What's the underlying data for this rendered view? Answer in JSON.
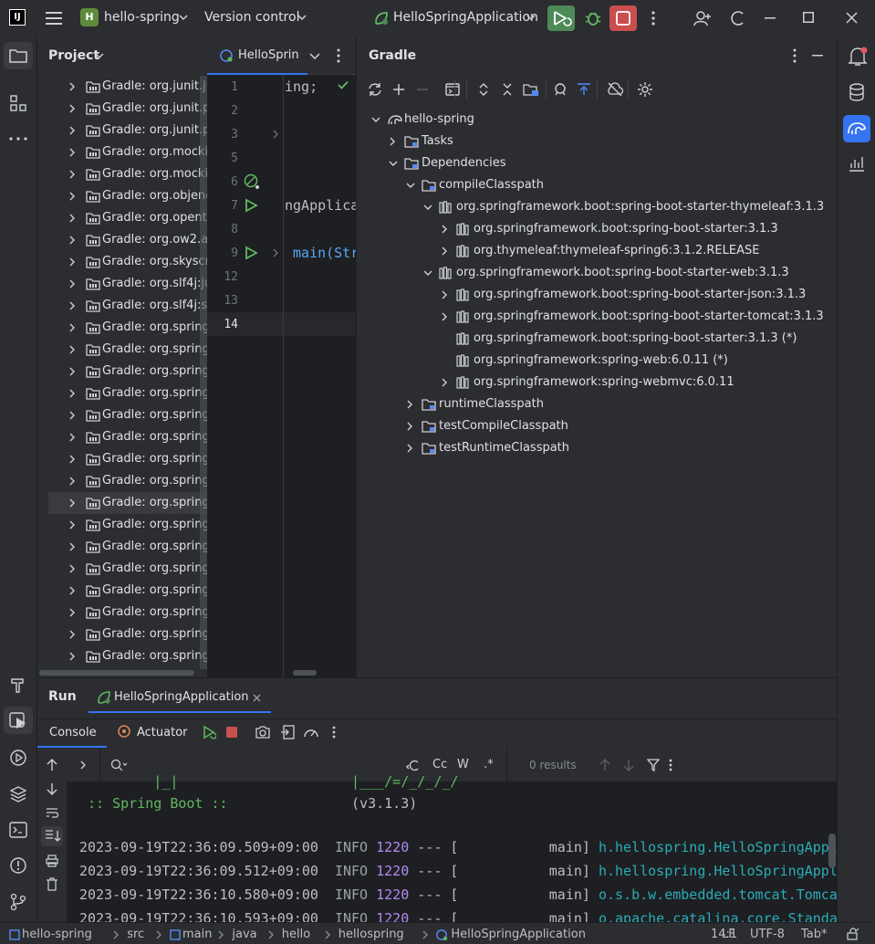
{
  "titlebar": {
    "project_badge": "H",
    "project_name": "hello-spring",
    "vcs": "Version control",
    "run_config": "HelloSpringApplication"
  },
  "project_panel": {
    "title": "Project",
    "rows": [
      "Gradle: org.junit.ju",
      "Gradle: org.junit.pl",
      "Gradle: org.junit.pl",
      "Gradle: org.mockit",
      "Gradle: org.mockit",
      "Gradle: org.objene",
      "Gradle: org.opente",
      "Gradle: org.ow2.as",
      "Gradle: org.skyscre",
      "Gradle: org.slf4j:ju",
      "Gradle: org.slf4j:sl",
      "Gradle: org.springf",
      "Gradle: org.springf",
      "Gradle: org.springf",
      "Gradle: org.springf",
      "Gradle: org.springf",
      "Gradle: org.springf",
      "Gradle: org.springf",
      "Gradle: org.springf",
      "Gradle: org.springf",
      "Gradle: org.springf",
      "Gradle: org.springf",
      "Gradle: org.springf",
      "Gradle: org.springf",
      "Gradle: org.springf",
      "Gradle: org.springf",
      "Gradle: org.springf"
    ],
    "selected_index": 19
  },
  "editor": {
    "tab_label": "HelloSprin",
    "line_numbers": [
      "1",
      "2",
      "3",
      "5",
      "6",
      "7",
      "8",
      "9",
      "12",
      "13",
      "14"
    ],
    "code": {
      "l1": "ing;",
      "l7": "ngApplica",
      "l9": "main(Str"
    }
  },
  "gradle": {
    "title": "Gradle",
    "tree": [
      {
        "label": "hello-spring",
        "level": 0,
        "expanded": true,
        "icon": "gradle-elephant-icon"
      },
      {
        "label": "Tasks",
        "level": 1,
        "expanded": false,
        "icon": "folder-icon"
      },
      {
        "label": "Dependencies",
        "level": 1,
        "expanded": true,
        "icon": "folder-icon"
      },
      {
        "label": "compileClasspath",
        "level": 2,
        "expanded": true,
        "icon": "folder-icon"
      },
      {
        "label": "org.springframework.boot:spring-boot-starter-thymeleaf:3.1.3",
        "level": 3,
        "expanded": true,
        "icon": "library-icon"
      },
      {
        "label": "org.springframework.boot:spring-boot-starter:3.1.3",
        "level": 4,
        "expanded": false,
        "icon": "library-icon"
      },
      {
        "label": "org.thymeleaf:thymeleaf-spring6:3.1.2.RELEASE",
        "level": 4,
        "expanded": false,
        "icon": "library-icon"
      },
      {
        "label": "org.springframework.boot:spring-boot-starter-web:3.1.3",
        "level": 3,
        "expanded": true,
        "icon": "library-icon"
      },
      {
        "label": "org.springframework.boot:spring-boot-starter-json:3.1.3",
        "level": 4,
        "expanded": false,
        "icon": "library-icon"
      },
      {
        "label": "org.springframework.boot:spring-boot-starter-tomcat:3.1.3",
        "level": 4,
        "expanded": false,
        "icon": "library-icon"
      },
      {
        "label": "org.springframework.boot:spring-boot-starter:3.1.3 (*)",
        "level": 4,
        "leaf": true,
        "icon": "library-icon"
      },
      {
        "label": "org.springframework:spring-web:6.0.11 (*)",
        "level": 4,
        "leaf": true,
        "icon": "library-icon"
      },
      {
        "label": "org.springframework:spring-webmvc:6.0.11",
        "level": 4,
        "expanded": false,
        "icon": "library-icon"
      },
      {
        "label": "runtimeClasspath",
        "level": 2,
        "expanded": false,
        "icon": "folder-icon"
      },
      {
        "label": "testCompileClasspath",
        "level": 2,
        "expanded": false,
        "icon": "folder-icon"
      },
      {
        "label": "testRuntimeClasspath",
        "level": 2,
        "expanded": false,
        "icon": "folder-icon"
      }
    ]
  },
  "run_panel": {
    "title": "Run",
    "tab": "HelloSpringApplication",
    "subtabs": {
      "console": "Console",
      "actuator": "Actuator"
    },
    "search": {
      "results": "0 results",
      "cc": "Cc",
      "w": "W",
      "regex": ".*"
    },
    "log": {
      "banner_cut": "         |_|                     |___/=/_/_/_/",
      "banner_name": " :: Spring Boot :: ",
      "banner_version": "              (v3.1.3)",
      "lines": [
        {
          "time": "2023-09-19T22:36:09.509+09:00",
          "level": "INFO",
          "pid": "1220",
          "sep": " --- [",
          "thread": "           main]",
          "logger": "h.hellospring.HelloSpringAppl"
        },
        {
          "time": "2023-09-19T22:36:09.512+09:00",
          "level": "INFO",
          "pid": "1220",
          "sep": " --- [",
          "thread": "           main]",
          "logger": "h.hellospring.HelloSpringAppl"
        },
        {
          "time": "2023-09-19T22:36:10.580+09:00",
          "level": "INFO",
          "pid": "1220",
          "sep": " --- [",
          "thread": "           main]",
          "logger": "o.s.b.w.embedded.tomcat.Tomcat"
        },
        {
          "time": "2023-09-19T22:36:10.593+09:00",
          "level": "INFO",
          "pid": "1220",
          "sep": " --- [",
          "thread": "           main]",
          "logger": "o.apache.catalina.core.Standar"
        }
      ]
    }
  },
  "statusbar": {
    "crumbs": [
      "hello-spring",
      "src",
      "main",
      "java",
      "hello",
      "hellospring",
      "HelloSpringApplication"
    ],
    "position": "14:1",
    "line_sep": "LF",
    "encoding": "UTF-8",
    "indent": "Tab*"
  },
  "colors": {
    "accent": "#3574f0",
    "run_green": "#4d8a58",
    "stop_red": "#c94f4f",
    "spring_green": "#5fb85f",
    "info_gray": "#9da0a8",
    "pid_purple": "#b189f5",
    "logger_teal": "#2aacb8"
  }
}
